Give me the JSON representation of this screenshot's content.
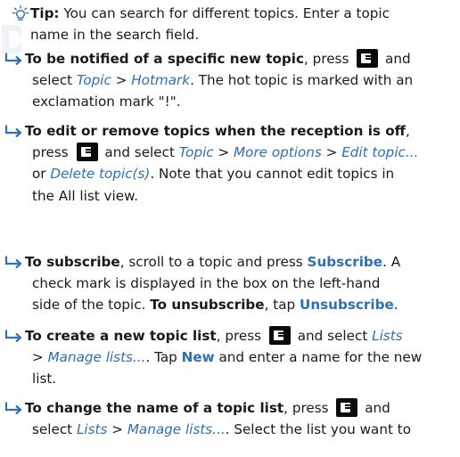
{
  "watermark": "DRAFT",
  "tip": {
    "icon": "lightbulb-icon",
    "label": "Tip:",
    "line1": "You can search for different topics. Enter a topic",
    "line2": "name in the search field."
  },
  "sections": {
    "notify": {
      "icon": "right-arrow-icon",
      "bold": "To be notified of a specific new topic",
      "t1": ", press",
      "t2": "and",
      "t3": "select",
      "opt1": "Topic",
      "sep1": ">",
      "opt2": "Hotmark",
      "t4": ". The hot topic is marked with an",
      "line3": "exclamation mark \"!\"."
    },
    "edit": {
      "icon": "right-arrow-icon",
      "bold": "To edit or remove topics when the reception is off",
      "t1": ",",
      "t2": "press",
      "t3": "and select",
      "opt1": "Topic",
      "sep1": ">",
      "opt2": "More options",
      "sep2": ">",
      "opt3": "Edit topic...",
      "t4": "or",
      "opt4": "Delete topic(s)",
      "t5": ". Note that you cannot edit topics in",
      "line4": "the All list view."
    },
    "subscribe": {
      "icon": "right-arrow-icon",
      "bold": "To subscribe",
      "t1": ", scroll to a topic and press",
      "lbl1": "Subscribe",
      "t2": ". A",
      "line2": "check mark is displayed in the box on the left-hand",
      "t3": "side of the topic.",
      "bold2": "To unsubscribe",
      "t4": ", tap",
      "lbl2": "Unsubscribe",
      "t5": "."
    },
    "create": {
      "icon": "right-arrow-icon",
      "bold": "To create a new topic list",
      "t1": ", press",
      "t2": "and select",
      "opt1": "Lists",
      "sep1": ">",
      "opt2": "Manage lists...",
      "t3": ". Tap",
      "lbl1": "New",
      "t4": "and enter a name for the new",
      "line3": "list."
    },
    "rename": {
      "icon": "right-arrow-icon",
      "bold": "To change the name of a topic list",
      "t1": ", press",
      "t2": "and",
      "t3": "select",
      "opt1": "Lists",
      "sep1": ">",
      "opt2": "Manage lists...",
      "t4": ". Select the list you want to"
    }
  }
}
